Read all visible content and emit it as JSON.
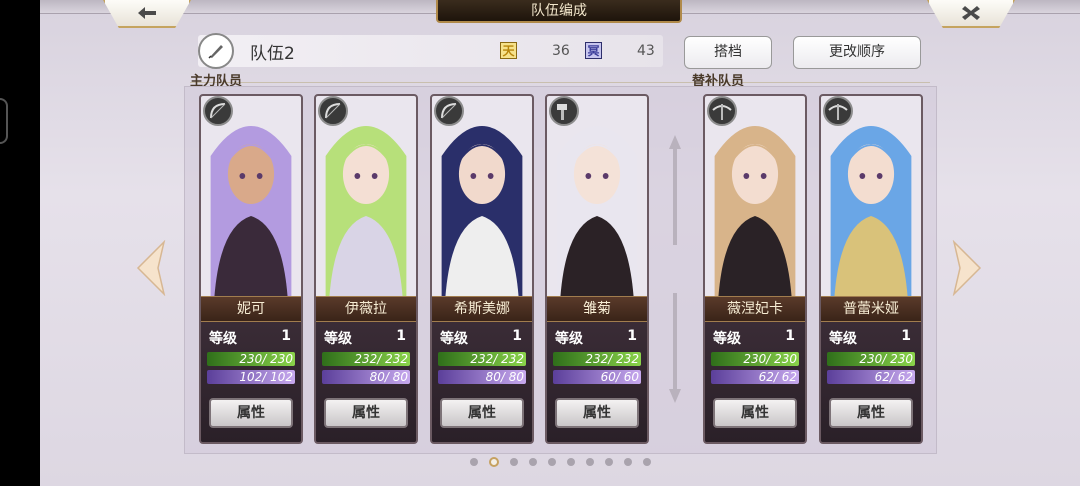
{
  "header": {
    "title": "队伍编成",
    "back_icon": "left-arrow-icon",
    "close_icon": "close-icon"
  },
  "team": {
    "name": "队伍2",
    "heaven_label": "天",
    "heaven_value": "36",
    "hell_label": "冥",
    "hell_value": "43",
    "partner_label": "搭档",
    "reorder_label": "更改顺序"
  },
  "sections": {
    "main_label": "主力队员",
    "sub_label": "替补队员"
  },
  "level_label": "等级",
  "attr_button_label": "属性",
  "cards": [
    {
      "name": "妮可",
      "level": "1",
      "hp": "230/ 230",
      "hp_fill": 1.0,
      "mp": "102/ 102",
      "mp_fill": 1.0,
      "weapon": "bow-icon",
      "hair": "#b39be0",
      "skin": "#d9a98a",
      "outfit": "#3a2a3a"
    },
    {
      "name": "伊薇拉",
      "level": "1",
      "hp": "232/ 232",
      "hp_fill": 1.0,
      "mp": "80/ 80",
      "mp_fill": 1.0,
      "weapon": "bow-icon",
      "hair": "#b7e07a",
      "skin": "#f4dfd4",
      "outfit": "#d9d4e6"
    },
    {
      "name": "希斯美娜",
      "level": "1",
      "hp": "232/ 232",
      "hp_fill": 1.0,
      "mp": "80/ 80",
      "mp_fill": 1.0,
      "weapon": "bow-icon",
      "hair": "#2a2f6a",
      "skin": "#f1d9cc",
      "outfit": "#eeeeee"
    },
    {
      "name": "雏菊",
      "level": "1",
      "hp": "232/ 232",
      "hp_fill": 1.0,
      "mp": "60/ 60",
      "mp_fill": 1.0,
      "weapon": "hammer-icon",
      "hair": "#e9e6ef",
      "skin": "#f4e2d8",
      "outfit": "#2b2226"
    },
    {
      "name": "薇涅妃卡",
      "level": "1",
      "hp": "230/ 230",
      "hp_fill": 1.0,
      "mp": "62/ 62",
      "mp_fill": 1.0,
      "weapon": "crossbow-icon",
      "hair": "#d8b48a",
      "skin": "#f3ddd0",
      "outfit": "#2a2226"
    },
    {
      "name": "普蕾米娅",
      "level": "1",
      "hp": "230/ 230",
      "hp_fill": 1.0,
      "mp": "62/ 62",
      "mp_fill": 1.0,
      "weapon": "crossbow-icon",
      "hair": "#6aa6e6",
      "skin": "#f3ddd0",
      "outfit": "#d9c27a"
    }
  ],
  "pager": {
    "pages": 10,
    "active": 1
  }
}
